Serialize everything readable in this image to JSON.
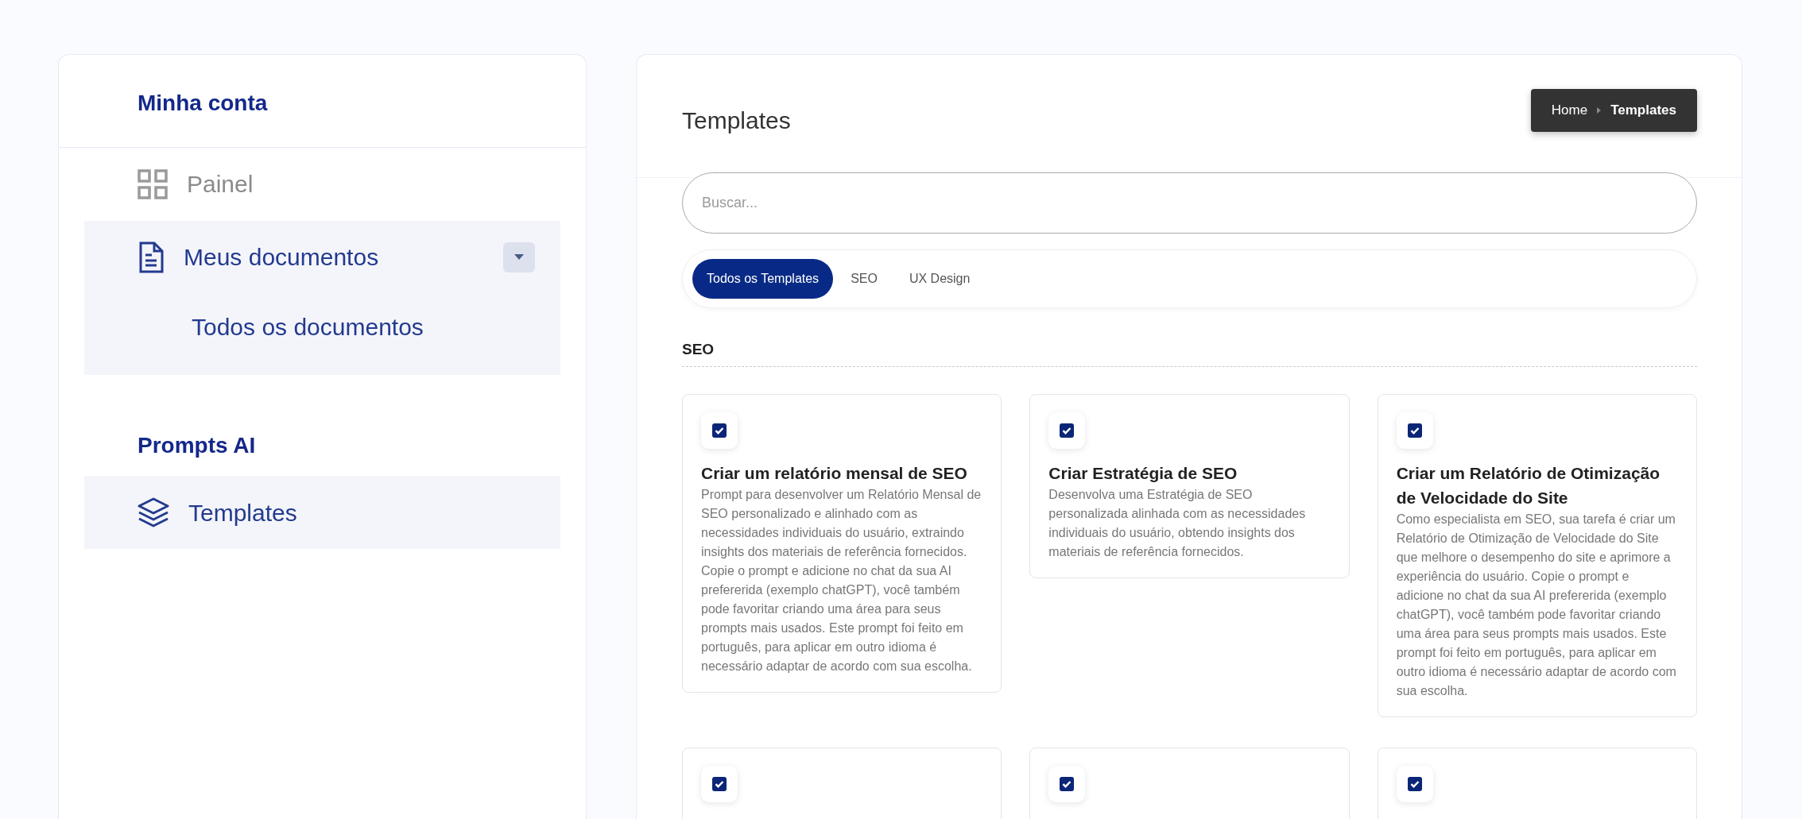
{
  "sidebar": {
    "sections": [
      {
        "title": "Minha conta",
        "items": [
          {
            "label": "Painel",
            "selected": false
          },
          {
            "label": "Meus documentos",
            "selected": true,
            "expanded": true,
            "children": [
              {
                "label": "Todos os documentos"
              }
            ]
          }
        ]
      },
      {
        "title": "Prompts AI",
        "items": [
          {
            "label": "Templates",
            "selected": true
          }
        ]
      }
    ]
  },
  "page": {
    "title": "Templates",
    "breadcrumb": [
      {
        "label": "Home",
        "current": false
      },
      {
        "label": "Templates",
        "current": true
      }
    ]
  },
  "search": {
    "placeholder": "Buscar..."
  },
  "filters": [
    {
      "label": "Todos os Templates",
      "selected": true
    },
    {
      "label": "SEO",
      "selected": false
    },
    {
      "label": "UX Design",
      "selected": false
    }
  ],
  "section_title": "SEO",
  "cards": [
    {
      "checked": true,
      "title": "Criar um relatório mensal de SEO",
      "description": "Prompt para desenvolver um Relatório Mensal de SEO personalizado e alinhado com as necessidades individuais do usuário, extraindo insights dos materiais de referência fornecidos. Copie o prompt e adicione no chat da sua AI prefererida (exemplo chatGPT), você também pode favoritar criando uma área para seus prompts mais usados. Este prompt foi feito em português, para aplicar em outro idioma é necessário adaptar de acordo com sua escolha."
    },
    {
      "checked": true,
      "title": "Criar Estratégia de SEO",
      "description": "Desenvolva uma Estratégia de SEO personalizada alinhada com as necessidades individuais do usuário, obtendo insights dos materiais de referência fornecidos."
    },
    {
      "checked": true,
      "title": "Criar um Relatório de Otimização de Velocidade do Site",
      "description": "Como especialista em SEO, sua tarefa é criar um Relatório de Otimização de Velocidade do Site que melhore o desempenho do site e aprimore a experiência do usuário. Copie o prompt e adicione no chat da sua AI prefererida (exemplo chatGPT), você também pode favoritar criando uma área para seus prompts mais usados. Este prompt foi feito em português, para aplicar em outro idioma é necessário adaptar de acordo com sua escolha."
    },
    {
      "checked": true
    },
    {
      "checked": true
    },
    {
      "checked": true
    }
  ]
}
